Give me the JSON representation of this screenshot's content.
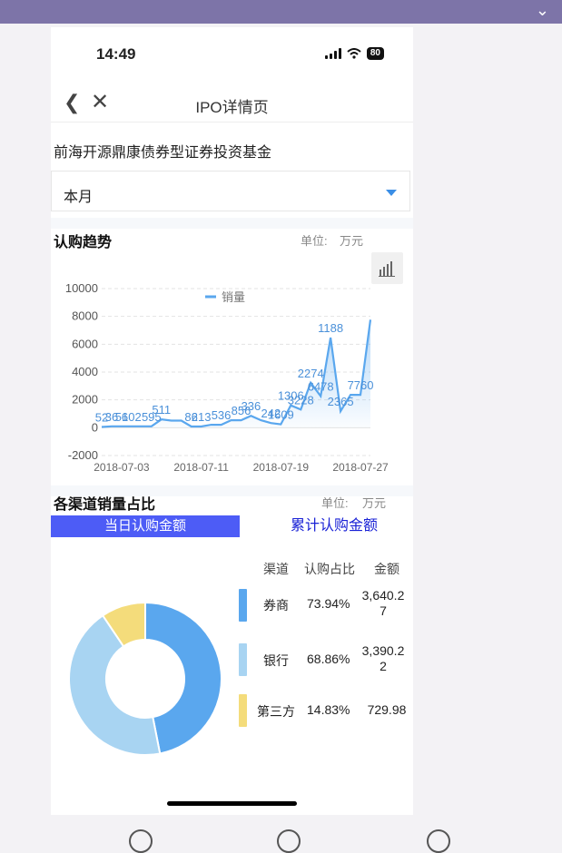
{
  "statusbar": {
    "time": "14:49",
    "battery": "80"
  },
  "nav": {
    "title": "IPO详情页"
  },
  "fund": {
    "name": "前海开源鼎康债券型证券投资基金"
  },
  "period_select": {
    "value": "本月"
  },
  "trend": {
    "title": "认购趋势",
    "unit_label": "单位:",
    "unit_value": "万元"
  },
  "channel": {
    "title": "各渠道销量占比",
    "unit_label": "单位:",
    "unit_value": "万元",
    "tab_daily": "当日认购金额",
    "tab_cumulative": "累计认购金额",
    "headers": {
      "channel": "渠道",
      "ratio": "认购占比",
      "amount": "金额"
    },
    "rows": [
      {
        "name": "券商",
        "ratio": "73.94%",
        "amount": "3,640.27",
        "color": "#5aa7ee"
      },
      {
        "name": "银行",
        "ratio": "68.86%",
        "amount": "3,390.22",
        "color": "#a8d4f2"
      },
      {
        "name": "第三方",
        "ratio": "14.83%",
        "amount": "729.98",
        "color": "#f4dc7b"
      }
    ]
  },
  "chart_data": [
    {
      "type": "area",
      "series": [
        {
          "name": "销量",
          "x": [
            "2018-07-01",
            "2018-07-02",
            "2018-07-03",
            "2018-07-04",
            "2018-07-05",
            "2018-07-06",
            "2018-07-07",
            "2018-07-08",
            "2018-07-09",
            "2018-07-10",
            "2018-07-11",
            "2018-07-12",
            "2018-07-13",
            "2018-07-14",
            "2018-07-15",
            "2018-07-16",
            "2018-07-17",
            "2018-07-18",
            "2018-07-19",
            "2018-07-20",
            "2018-07-21",
            "2018-07-22",
            "2018-07-23",
            "2018-07-24",
            "2018-07-25",
            "2018-07-26",
            "2018-07-27",
            "2018-07-28"
          ],
          "values": [
            52,
            102,
            102,
            102,
            102,
            102,
            595,
            511,
            511,
            86,
            86,
            213,
            213,
            536,
            536,
            856,
            536,
            336,
            242,
            1609,
            1306,
            3228,
            2274,
            6478,
            1188,
            2365,
            2365,
            7760
          ]
        }
      ],
      "data_labels": [
        {
          "x": "2018-07-01",
          "text": "52"
        },
        {
          "x": "2018-07-02",
          "text": "36"
        },
        {
          "x": "2018-07-03",
          "text": "56"
        },
        {
          "x": "2018-07-04",
          "text": "102"
        },
        {
          "x": "2018-07-06",
          "text": "595"
        },
        {
          "x": "2018-07-07",
          "text": "511"
        },
        {
          "x": "2018-07-10",
          "text": "86"
        },
        {
          "x": "2018-07-11",
          "text": "213"
        },
        {
          "x": "2018-07-13",
          "text": "536"
        },
        {
          "x": "2018-07-15",
          "text": "856"
        },
        {
          "x": "2018-07-16",
          "text": "336"
        },
        {
          "x": "2018-07-18",
          "text": "242"
        },
        {
          "x": "2018-07-19",
          "text": "1609"
        },
        {
          "x": "2018-07-20",
          "text": "1306"
        },
        {
          "x": "2018-07-21",
          "text": "3228"
        },
        {
          "x": "2018-07-22",
          "text": "2274"
        },
        {
          "x": "2018-07-23",
          "text": "6478"
        },
        {
          "x": "2018-07-24",
          "text": "1188"
        },
        {
          "x": "2018-07-25",
          "text": "2365"
        },
        {
          "x": "2018-07-27",
          "text": "7760"
        }
      ],
      "x_tick_labels": [
        "2018-07-03",
        "2018-07-11",
        "2018-07-19",
        "2018-07-27"
      ],
      "y_ticks": [
        10000,
        8000,
        6000,
        4000,
        2000,
        0,
        -2000
      ],
      "ylim": [
        -2000,
        10000
      ],
      "legend": "top-center",
      "grid": true,
      "line_color": "#5aa7ee"
    },
    {
      "type": "pie",
      "categories": [
        "券商",
        "银行",
        "第三方"
      ],
      "values": [
        3640.27,
        3390.22,
        729.98
      ],
      "colors": [
        "#5aa7ee",
        "#a8d4f2",
        "#f4dc7b"
      ],
      "donut": true
    }
  ]
}
